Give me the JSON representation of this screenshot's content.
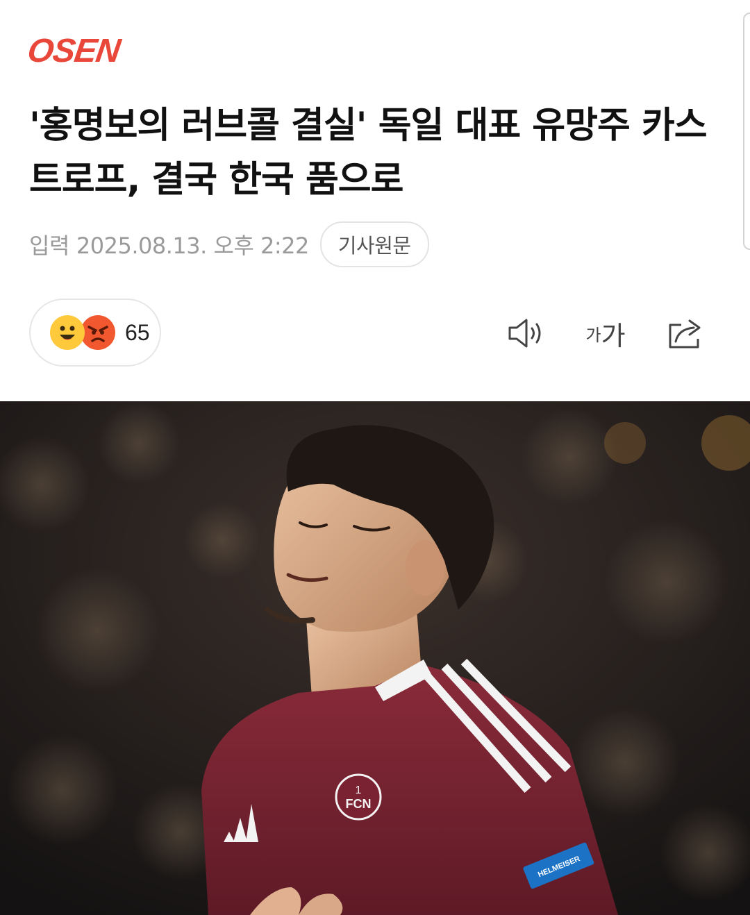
{
  "header": {
    "logo": "OSEN"
  },
  "article": {
    "title": "'홍명보의 러브콜 결실' 독일 대표 유망주 카스트로프, 결국 한국 품으로",
    "date_label": "입력",
    "date": "2025.08.13. 오후 2:22",
    "source_button": "기사원문"
  },
  "reactions": {
    "icons": [
      "happy-emoji-icon",
      "angry-emoji-icon"
    ],
    "count": "65"
  },
  "toolbar": {
    "icons": [
      "speaker-icon",
      "font-size-icon",
      "share-icon"
    ],
    "font_small": "가",
    "font_large": "가"
  },
  "photo": {
    "jersey_badge": "FCN",
    "jersey_number": "1",
    "sleeve_sponsor": "HELMEISER"
  },
  "colors": {
    "brand": "#e8473a",
    "jersey": "#7a2231",
    "meta_text": "#9a9a9a"
  }
}
